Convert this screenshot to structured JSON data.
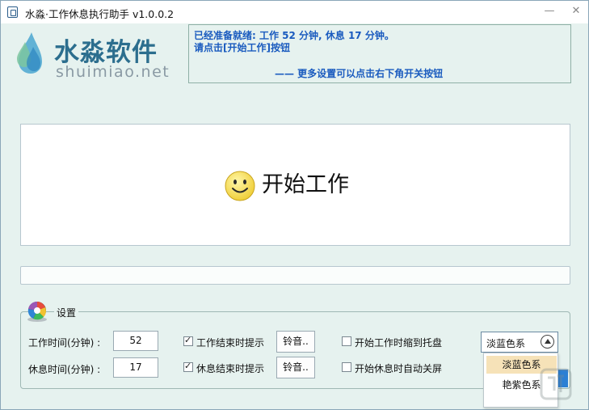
{
  "window": {
    "title": "水淼·工作休息执行助手 v1.0.0.2",
    "minimize_glyph": "—",
    "close_glyph": "✕"
  },
  "logo": {
    "cn_text": "水淼软件",
    "en_text": "shuimiao.net"
  },
  "notice": {
    "line1": "已经准备就绪: 工作 52 分钟, 休息 17 分钟。",
    "line2": "请点击[开始工作]按钮",
    "line3": "—— 更多设置可以点击右下角开关按钮"
  },
  "main": {
    "label": "开始工作",
    "icon": "smiley-icon"
  },
  "progress": {
    "value": 0
  },
  "settings": {
    "legend": "设置",
    "icon": "color-wheel-icon",
    "work_time_label": "工作时间(分钟) :",
    "work_time_value": "52",
    "rest_time_label": "休息时间(分钟) :",
    "rest_time_value": "17",
    "work_end_prompt_label": "工作结束时提示",
    "work_end_prompt_checked": true,
    "rest_end_prompt_label": "休息结束时提示",
    "rest_end_prompt_checked": true,
    "ringtone_button_1": "铃音..",
    "ringtone_button_2": "铃音..",
    "minimize_to_tray_label": "开始工作时缩到托盘",
    "minimize_to_tray_checked": false,
    "auto_screen_off_label": "开始休息时自动关屏",
    "auto_screen_off_checked": false,
    "theme_selected": "淡蓝色系",
    "theme_options": [
      "淡蓝色系",
      "艳紫色系"
    ]
  },
  "colors": {
    "window_bg": "#e6f2ef",
    "notice_text": "#1a5bbf",
    "logo_text": "#2c6e8e",
    "dropdown_highlight": "#f6e2b8",
    "toggle_button": "#2b7fd4"
  }
}
